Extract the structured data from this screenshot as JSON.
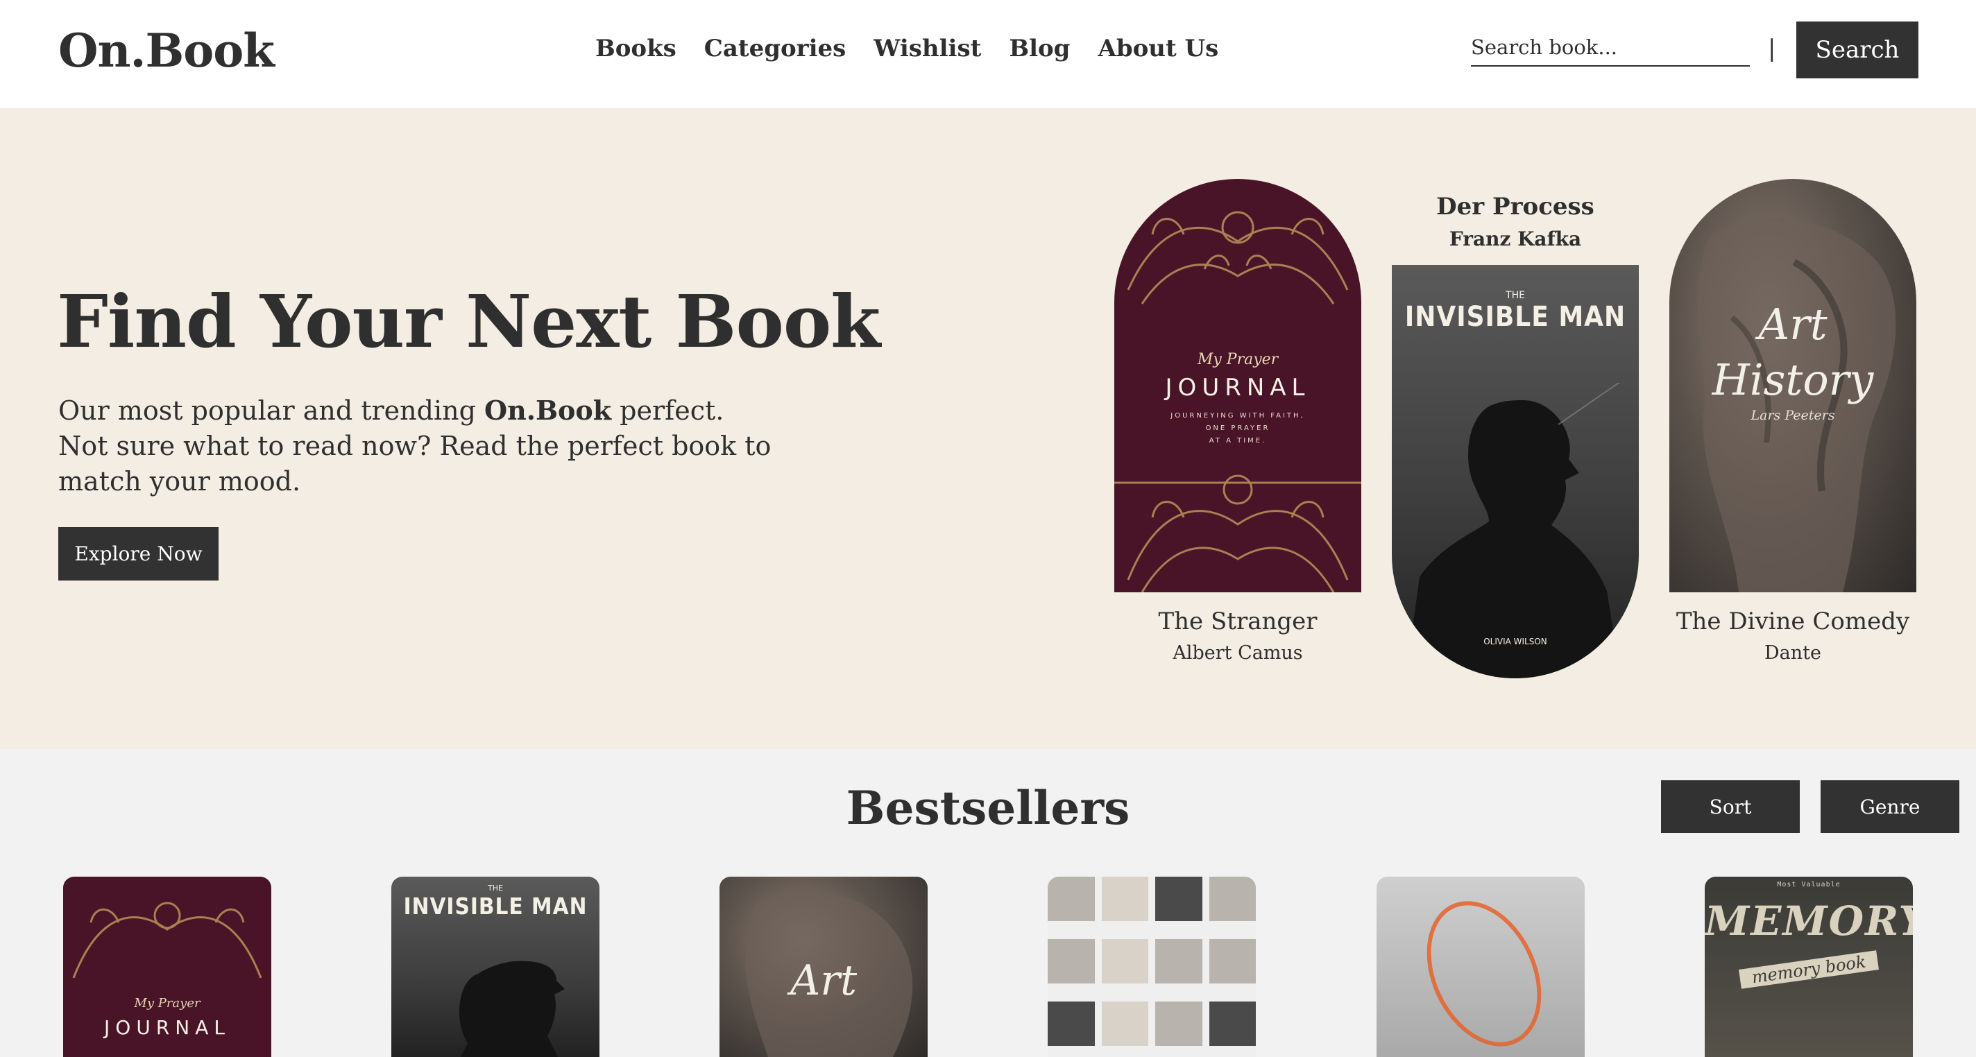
{
  "header": {
    "logo": "On.Book",
    "nav": [
      "Books",
      "Categories",
      "Wishlist",
      "Blog",
      "About Us"
    ],
    "search_placeholder": "Search book...",
    "divider": "|",
    "search_button": "Search"
  },
  "hero": {
    "title": "Find Your Next Book",
    "text_part1": "Our most popular and trending ",
    "text_bold": "On.Book",
    "text_part2": " perfect.",
    "text_line2": "Not sure what to read now? Read the perfect book to match your mood.",
    "cta": "Explore Now",
    "books": [
      {
        "title": "The Stranger",
        "author": "Albert Camus",
        "cover": {
          "small": "My Prayer",
          "big": "JOURNAL",
          "sub1": "JOURNEYING WITH FAITH,",
          "sub2": "ONE PRAYER",
          "sub3": "AT A TIME."
        }
      },
      {
        "title": "Der Process",
        "author": "Franz Kafka",
        "cover": {
          "the": "THE",
          "big": "INVISIBLE MAN",
          "author": "OLIVIA WILSON"
        }
      },
      {
        "title": "The Divine Comedy",
        "author": "Dante",
        "cover": {
          "line1": "Art",
          "line2": "History",
          "author": "Lars Peeters"
        }
      }
    ]
  },
  "bestsellers": {
    "title": "Bestsellers",
    "sort": "Sort",
    "genre": "Genre",
    "covers": {
      "journal_small": "My Prayer",
      "journal_big": "JOURNAL",
      "inv_the": "THE",
      "inv_big": "INVISIBLE MAN",
      "art": "Art",
      "memory_sub": "Most Valuable",
      "memory": "MEMORY",
      "memory_tag": "memory book"
    }
  }
}
